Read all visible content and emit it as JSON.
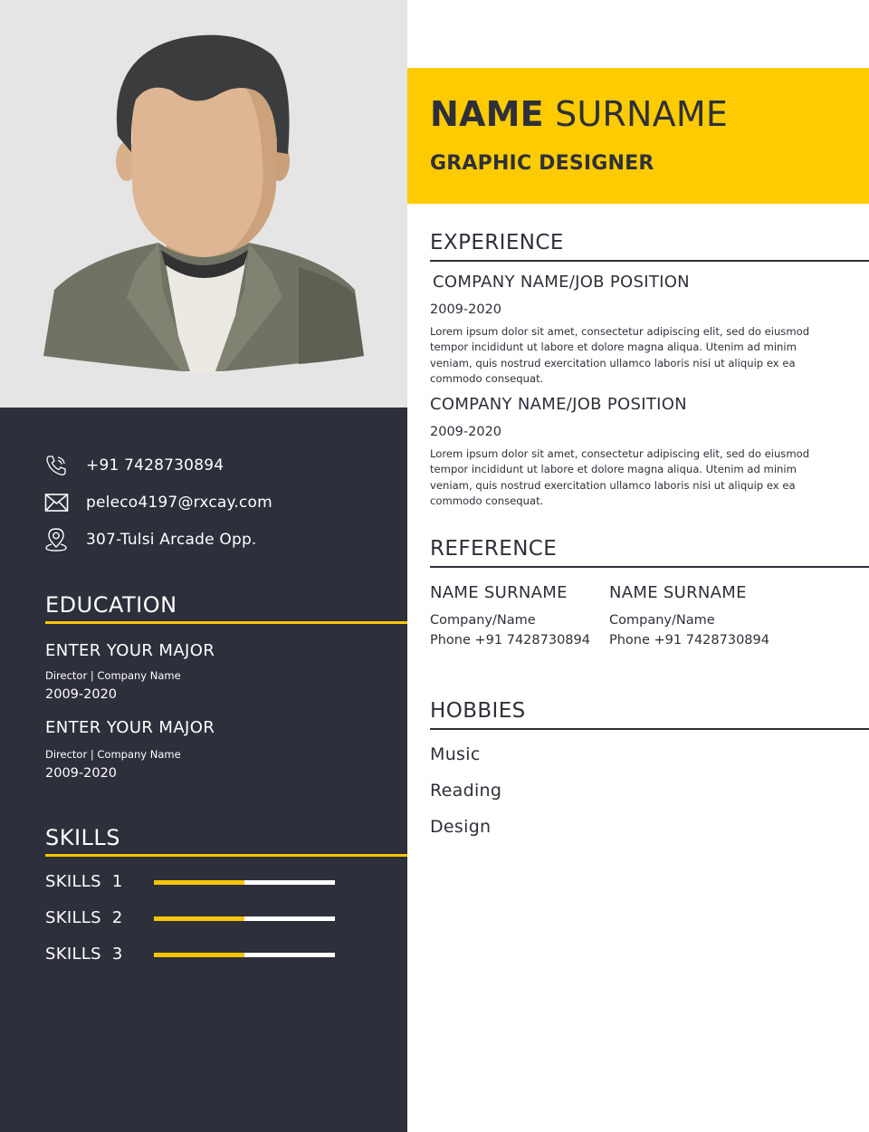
{
  "header": {
    "first_name": "NAME",
    "last_name": "SURNAME",
    "job_title": "GRAPHIC DESIGNER"
  },
  "contact": {
    "phone": "+91 7428730894",
    "email": "peleco4197@rxcay.com",
    "address": "307-Tulsi Arcade Opp.",
    "phone_icon": "phone-icon",
    "email_icon": "envelope-icon",
    "address_icon": "location-pin-icon"
  },
  "education": {
    "title": "EDUCATION",
    "items": [
      {
        "major": "ENTER YOUR MAJOR",
        "sub": "Director | Company Name",
        "years": "2009-2020"
      },
      {
        "major": "ENTER YOUR MAJOR",
        "sub": "Director | Company Name",
        "years": "2009-2020"
      }
    ]
  },
  "skills": {
    "title": "SKILLS",
    "items": [
      {
        "label": "SKILLS  1",
        "level": 0.5
      },
      {
        "label": "SKILLS  2",
        "level": 0.5
      },
      {
        "label": "SKILLS  3",
        "level": 0.5
      }
    ]
  },
  "experience": {
    "title": "EXPERIENCE",
    "items": [
      {
        "position": "COMPANY NAME/JOB POSITION",
        "years": "2009-2020",
        "description": "Lorem ipsum dolor sit amet, consectetur adipiscing elit, sed do eiusmod tempor incididunt ut labore et dolore magna aliqua. Utenim ad minim veniam, quis nostrud exercitation ullamco laboris nisi ut aliquip ex ea commodo consequat."
      },
      {
        "position": "COMPANY NAME/JOB POSITION",
        "years": "2009-2020",
        "description": "Lorem ipsum dolor sit amet, consectetur adipiscing elit, sed do eiusmod tempor incididunt ut labore et dolore magna aliqua. Utenim ad minim veniam, quis nostrud exercitation ullamco laboris nisi ut aliquip ex ea commodo consequat."
      }
    ]
  },
  "reference": {
    "title": "REFERENCE",
    "items": [
      {
        "name": "NAME SURNAME",
        "company": "Company/Name",
        "phone": "Phone +91 7428730894"
      },
      {
        "name": "NAME SURNAME",
        "company": "Company/Name",
        "phone": "Phone +91 7428730894"
      }
    ]
  },
  "hobbies": {
    "title": "HOBBIES",
    "items": [
      "Music",
      "Reading",
      "Design"
    ]
  },
  "colors": {
    "accent_yellow": "#fecb00",
    "dark_panel": "#2d2f3a",
    "photo_bg": "#e5e5e5",
    "text_dark": "#2e3039"
  }
}
